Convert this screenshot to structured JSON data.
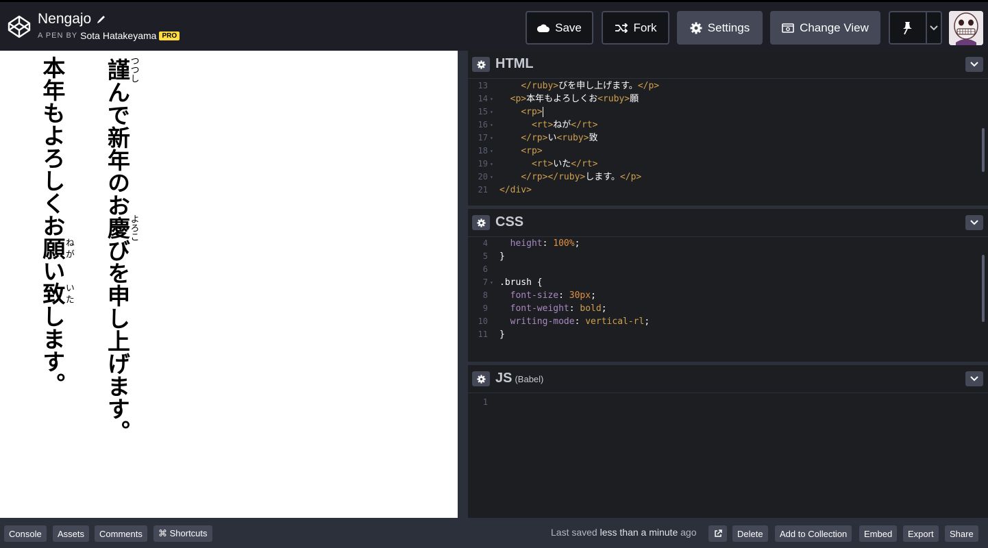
{
  "header": {
    "pen_title": "Nengajo",
    "by_label": "A PEN BY",
    "author": "Sota Hatakeyama",
    "badge": "PRO",
    "buttons": {
      "save": "Save",
      "fork": "Fork",
      "settings": "Settings",
      "change_view": "Change View"
    },
    "icons": [
      "codepen-logo-icon",
      "pencil-icon",
      "cloud-icon",
      "fork-icon",
      "gear-icon",
      "change-view-icon",
      "pin-icon",
      "chevron-down-icon",
      "avatar"
    ]
  },
  "preview": {
    "line1": {
      "a": "謹",
      "a_ruby": "つつし",
      "b": "んで新年のお",
      "c": "慶",
      "c_ruby": "よろこ",
      "d": "びを申し上げます。"
    },
    "line2": {
      "a": "本年もよろしくお",
      "b": "願",
      "b_ruby": "ねが",
      "c": "い",
      "d": "致",
      "d_ruby": "いた",
      "e": "します。"
    }
  },
  "editors": {
    "html": {
      "name": "HTML",
      "lines": [
        {
          "n": "13",
          "fold": "",
          "indent": "    ",
          "segs": [
            [
              "t",
              "</ruby>"
            ],
            [
              "p",
              "びを申し上げます。"
            ],
            [
              "t",
              "</p>"
            ]
          ]
        },
        {
          "n": "14",
          "fold": "▾",
          "indent": "  ",
          "segs": [
            [
              "t",
              "<p>"
            ],
            [
              "p",
              "本年もよろしくお"
            ],
            [
              "t",
              "<ruby>"
            ],
            [
              "p",
              "願"
            ]
          ]
        },
        {
          "n": "15",
          "fold": "▾",
          "indent": "    ",
          "segs": [
            [
              "t",
              "<rp>"
            ]
          ],
          "cursor": true
        },
        {
          "n": "16",
          "fold": "▾",
          "indent": "      ",
          "segs": [
            [
              "t",
              "<rt>"
            ],
            [
              "p",
              "ねが"
            ],
            [
              "t",
              "</rt>"
            ]
          ]
        },
        {
          "n": "17",
          "fold": "▾",
          "indent": "    ",
          "segs": [
            [
              "t",
              "</rp>"
            ],
            [
              "p",
              "い"
            ],
            [
              "t",
              "<ruby>"
            ],
            [
              "p",
              "致"
            ]
          ]
        },
        {
          "n": "18",
          "fold": "▾",
          "indent": "    ",
          "segs": [
            [
              "t",
              "<rp>"
            ]
          ]
        },
        {
          "n": "19",
          "fold": "▾",
          "indent": "      ",
          "segs": [
            [
              "t",
              "<rt>"
            ],
            [
              "p",
              "いた"
            ],
            [
              "t",
              "</rt>"
            ]
          ]
        },
        {
          "n": "20",
          "fold": "▾",
          "indent": "    ",
          "segs": [
            [
              "t",
              "</rp></ruby>"
            ],
            [
              "p",
              "します。"
            ],
            [
              "t",
              "</p>"
            ]
          ]
        },
        {
          "n": "21",
          "fold": "",
          "indent": "",
          "segs": [
            [
              "t",
              "</div>"
            ]
          ]
        }
      ]
    },
    "css": {
      "name": "CSS",
      "lines": [
        {
          "n": "4",
          "fold": "",
          "indent": "  ",
          "segs": [
            [
              "cp",
              "height"
            ],
            [
              "cs",
              ": "
            ],
            [
              "cv",
              "100%"
            ],
            [
              "cs",
              ";"
            ]
          ]
        },
        {
          "n": "5",
          "fold": "",
          "indent": "",
          "segs": [
            [
              "cs",
              "}"
            ]
          ]
        },
        {
          "n": "6",
          "fold": "",
          "indent": "",
          "segs": []
        },
        {
          "n": "7",
          "fold": "▾",
          "indent": "",
          "segs": [
            [
              "cs",
              ".brush {"
            ]
          ]
        },
        {
          "n": "8",
          "fold": "",
          "indent": "  ",
          "segs": [
            [
              "cp",
              "font-size"
            ],
            [
              "cs",
              ": "
            ],
            [
              "cv",
              "30px"
            ],
            [
              "cs",
              ";"
            ]
          ]
        },
        {
          "n": "9",
          "fold": "",
          "indent": "  ",
          "segs": [
            [
              "cp",
              "font-weight"
            ],
            [
              "cs",
              ": "
            ],
            [
              "t",
              "bold"
            ],
            [
              "cs",
              ";"
            ]
          ]
        },
        {
          "n": "10",
          "fold": "",
          "indent": "  ",
          "segs": [
            [
              "cp",
              "writing-mode"
            ],
            [
              "cs",
              ": "
            ],
            [
              "t",
              "vertical-rl"
            ],
            [
              "cs",
              ";"
            ]
          ]
        },
        {
          "n": "11",
          "fold": "",
          "indent": "",
          "segs": [
            [
              "cs",
              "}"
            ]
          ]
        }
      ]
    },
    "js": {
      "name": "JS",
      "sub": "(Babel)",
      "lines": [
        {
          "n": "1",
          "fold": "",
          "indent": "",
          "segs": []
        }
      ]
    }
  },
  "footer": {
    "left_buttons": [
      "Console",
      "Assets",
      "Comments",
      "⌘ Shortcuts"
    ],
    "saved_prefix": "Last saved",
    "saved_time": "less than a minute",
    "saved_suffix": "ago",
    "right_buttons": [
      "Delete",
      "Add to Collection",
      "Embed",
      "Export",
      "Share"
    ]
  },
  "colors": {
    "header_bg": "#1e1f26",
    "editor_bg": "#1d1e22",
    "button_gray": "#444857",
    "pro_badge": "#ffdd40",
    "tag": "#cfa04e",
    "css_property": "#a88ac1",
    "css_value": "#e09142"
  }
}
